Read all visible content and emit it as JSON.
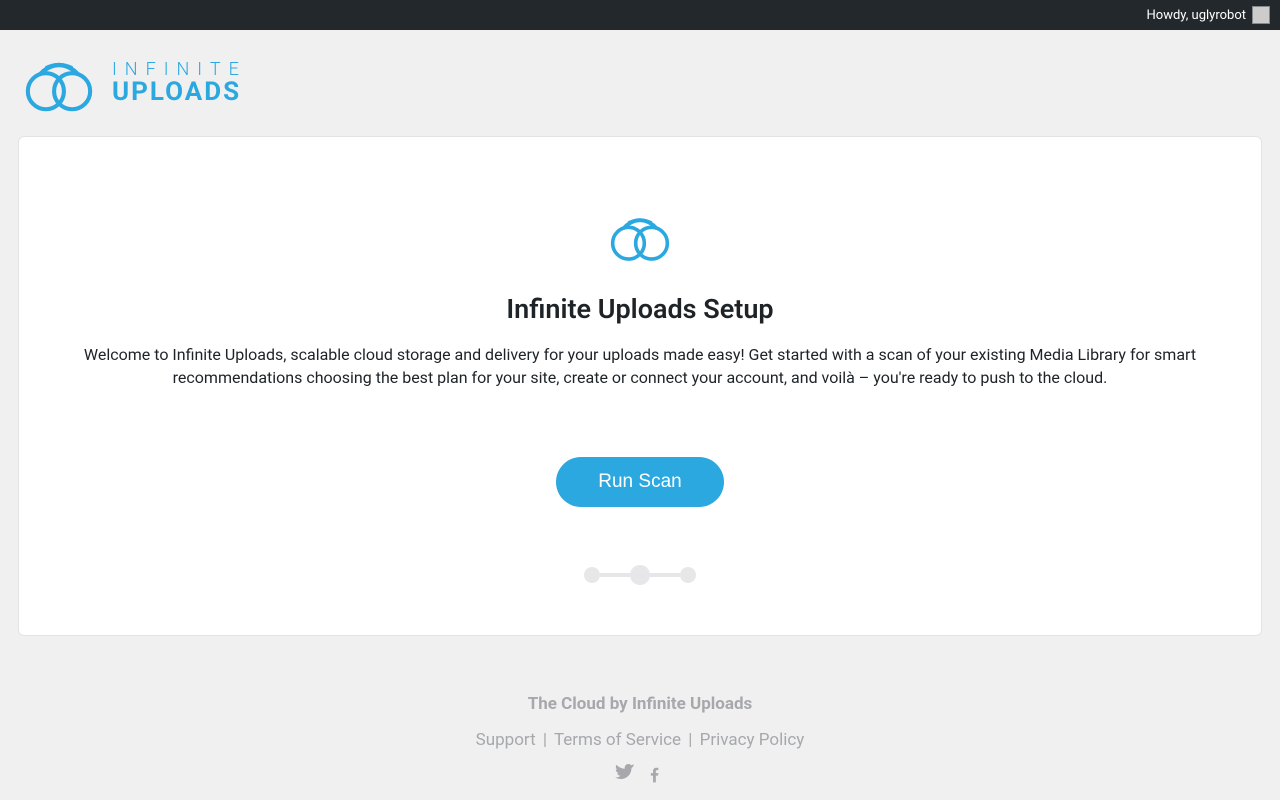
{
  "adminbar": {
    "greeting": "Howdy, uglyrobot"
  },
  "brand": {
    "line1": "INFINITE",
    "line2": "UPLOADS"
  },
  "card": {
    "title": "Infinite Uploads Setup",
    "description": "Welcome to Infinite Uploads, scalable cloud storage and delivery for your uploads made easy! Get started with a scan of your existing Media Library for smart recommendations choosing the best plan for your site, create or connect your account, and voilà – you're ready to push to the cloud.",
    "run_label": "Run Scan"
  },
  "footer": {
    "title": "The Cloud by Infinite Uploads",
    "support": "Support",
    "tos": "Terms of Service",
    "privacy": "Privacy Policy",
    "sep": "|"
  }
}
